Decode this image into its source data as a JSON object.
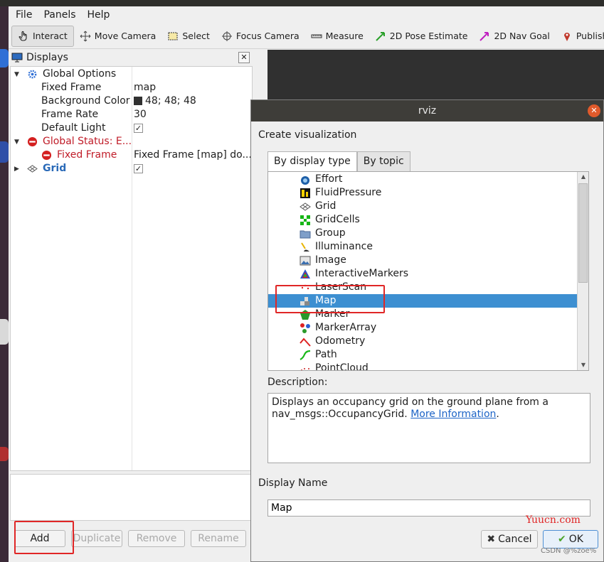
{
  "menubar": {
    "file": "File",
    "panels": "Panels",
    "help": "Help"
  },
  "toolbar": {
    "interact": "Interact",
    "move_camera": "Move Camera",
    "select": "Select",
    "focus_camera": "Focus Camera",
    "measure": "Measure",
    "pose_estimate": "2D Pose Estimate",
    "nav_goal": "2D Nav Goal",
    "publish_point": "Publish Poi"
  },
  "displays": {
    "title": "Displays",
    "global_options": "Global Options",
    "fixed_frame_key": "Fixed Frame",
    "fixed_frame_val": "map",
    "bg_color_key": "Background Color",
    "bg_color_val": "48; 48; 48",
    "frame_rate_key": "Frame Rate",
    "frame_rate_val": "30",
    "default_light_key": "Default Light",
    "global_status": "Global Status: E...",
    "fixed_frame_err_key": "Fixed Frame",
    "fixed_frame_err_val": "Fixed Frame [map] do...",
    "grid": "Grid",
    "check": "✓"
  },
  "panel_buttons": {
    "add": "Add",
    "duplicate": "Duplicate",
    "remove": "Remove",
    "rename": "Rename"
  },
  "dialog": {
    "title": "rviz",
    "create_label": "Create visualization",
    "tab_display_type": "By display type",
    "tab_topic": "By topic",
    "items": [
      "Effort",
      "FluidPressure",
      "Grid",
      "GridCells",
      "Group",
      "Illuminance",
      "Image",
      "InteractiveMarkers",
      "LaserScan",
      "Map",
      "Marker",
      "MarkerArray",
      "Odometry",
      "Path",
      "PointCloud"
    ],
    "selected": "Map",
    "description_label": "Description:",
    "description_text": "Displays an occupancy grid on the ground plane from a nav_msgs::OccupancyGrid. ",
    "more_info": "More Information",
    "description_end": ".",
    "display_name_label": "Display Name",
    "display_name_value": "Map",
    "cancel": "Cancel",
    "ok": "OK"
  },
  "watermark": {
    "site": "Yuucn.com",
    "credit": "CSDN @%zoe%"
  },
  "colors": {
    "accent": "#3d8fd1",
    "highlight": "#e02626",
    "error": "#c01c28"
  }
}
